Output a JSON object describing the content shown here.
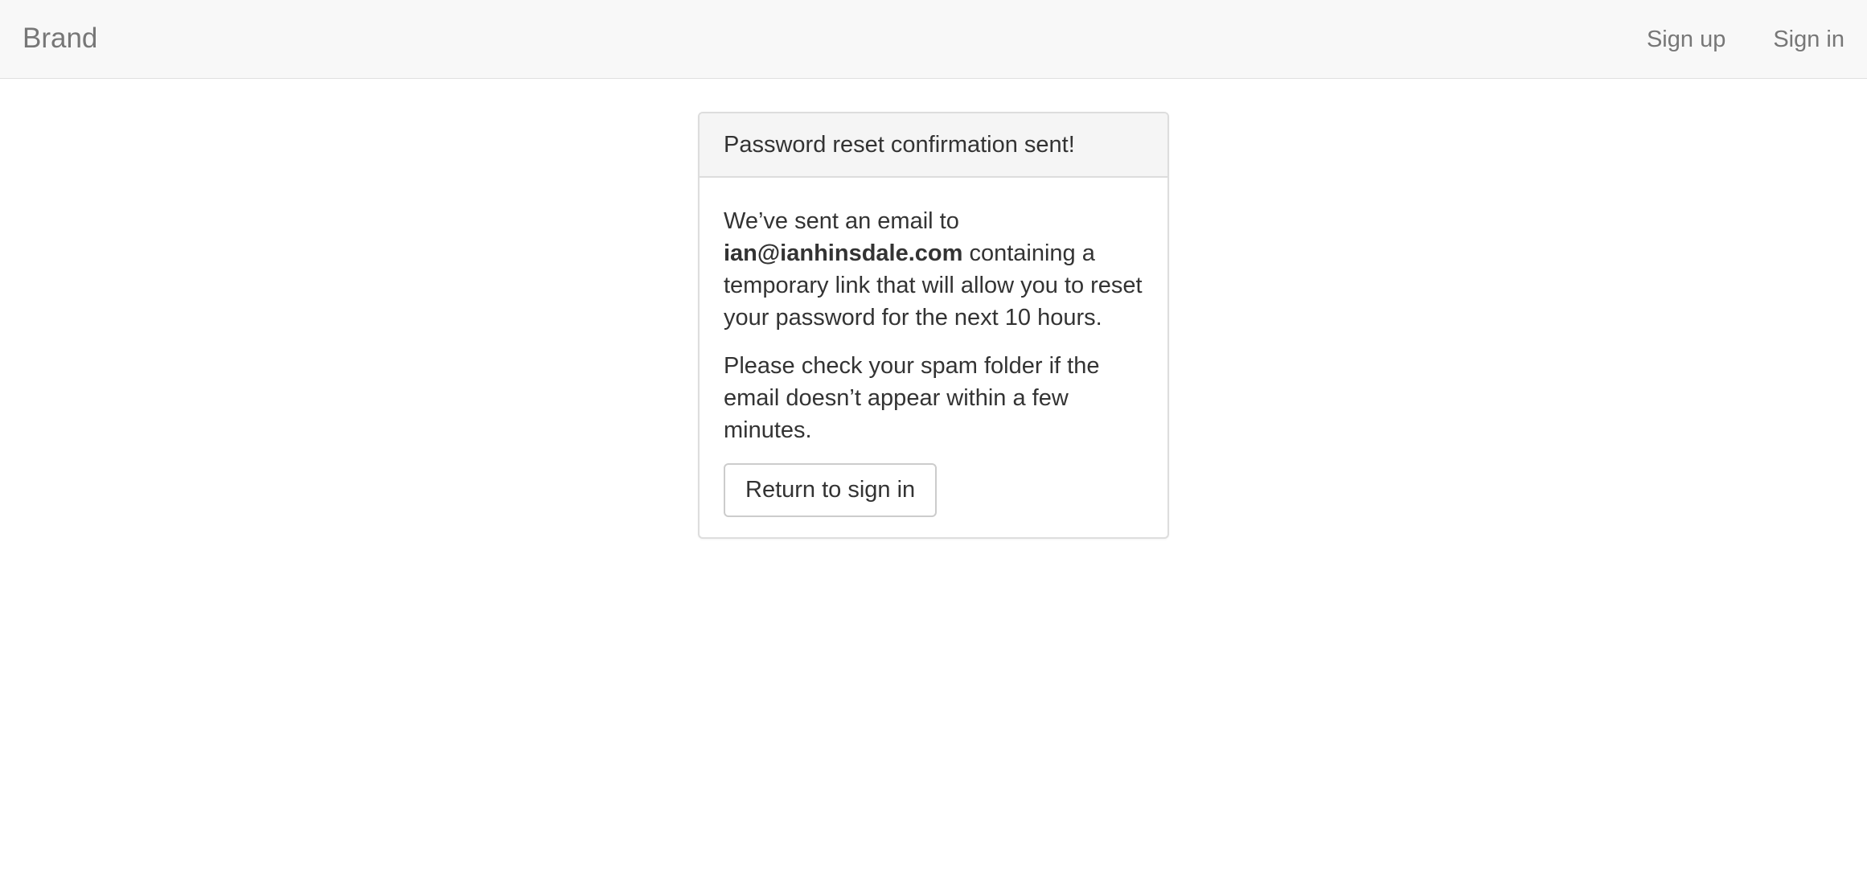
{
  "navbar": {
    "brand": "Brand",
    "links": [
      {
        "label": "Sign up"
      },
      {
        "label": "Sign in"
      }
    ]
  },
  "panel": {
    "heading": "Password reset confirmation sent!",
    "message": {
      "before_email": "We’ve sent an email to ",
      "email": "ian@ianhinsdale.com",
      "after_email": " containing a temporary link that will allow you to reset your password for the next 10 hours."
    },
    "note": "Please check your spam folder if the email doesn’t appear within a few minutes.",
    "button_label": "Return to sign in"
  }
}
